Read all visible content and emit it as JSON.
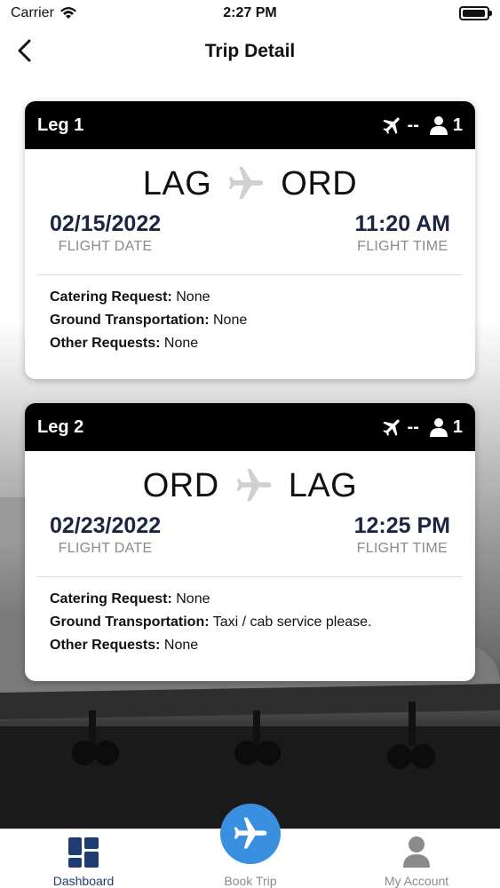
{
  "status_bar": {
    "carrier": "Carrier",
    "time": "2:27 PM"
  },
  "nav": {
    "title": "Trip Detail"
  },
  "legs": [
    {
      "title": "Leg 1",
      "aircraft": "--",
      "passengers": "1",
      "from": "LAG",
      "to": "ORD",
      "date": "02/15/2022",
      "date_label": "FLIGHT DATE",
      "time": "11:20 AM",
      "time_label": "FLIGHT TIME",
      "catering_label": "Catering Request:",
      "catering": "None",
      "ground_label": "Ground Transportation:",
      "ground": "None",
      "other_label": "Other Requests:",
      "other": "None"
    },
    {
      "title": "Leg 2",
      "aircraft": "--",
      "passengers": "1",
      "from": "ORD",
      "to": "LAG",
      "date": "02/23/2022",
      "date_label": "FLIGHT DATE",
      "time": "12:25 PM",
      "time_label": "FLIGHT TIME",
      "catering_label": "Catering Request:",
      "catering": "None",
      "ground_label": "Ground Transportation:",
      "ground": "Taxi / cab service please.",
      "other_label": "Other Requests:",
      "other": "None"
    }
  ],
  "tabs": {
    "dashboard": "Dashboard",
    "book": "Book Trip",
    "account": "My Account"
  },
  "colors": {
    "accent": "#1f3d73",
    "book_button": "#3b8fe0",
    "header": "#000000"
  }
}
